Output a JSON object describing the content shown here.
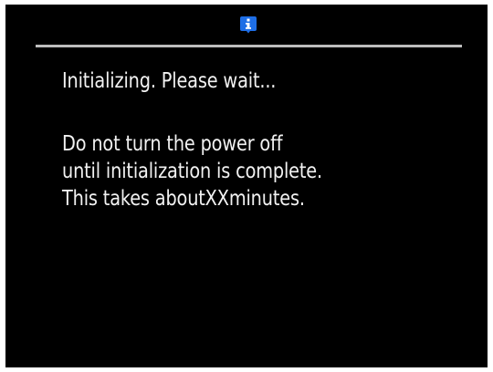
{
  "colors": {
    "screen_background": "#000000",
    "text": "#f2f2f2",
    "divider": "#bdbdbd",
    "info_icon_background": "#1e6ee6",
    "info_icon_glyph": "#ffffff"
  },
  "header": {
    "icon": "info-icon"
  },
  "message": {
    "title": "Initializing. Please wait...",
    "lines": [
      "Do not turn the power off",
      "until initialization is complete.",
      "This takes aboutXXminutes."
    ]
  }
}
